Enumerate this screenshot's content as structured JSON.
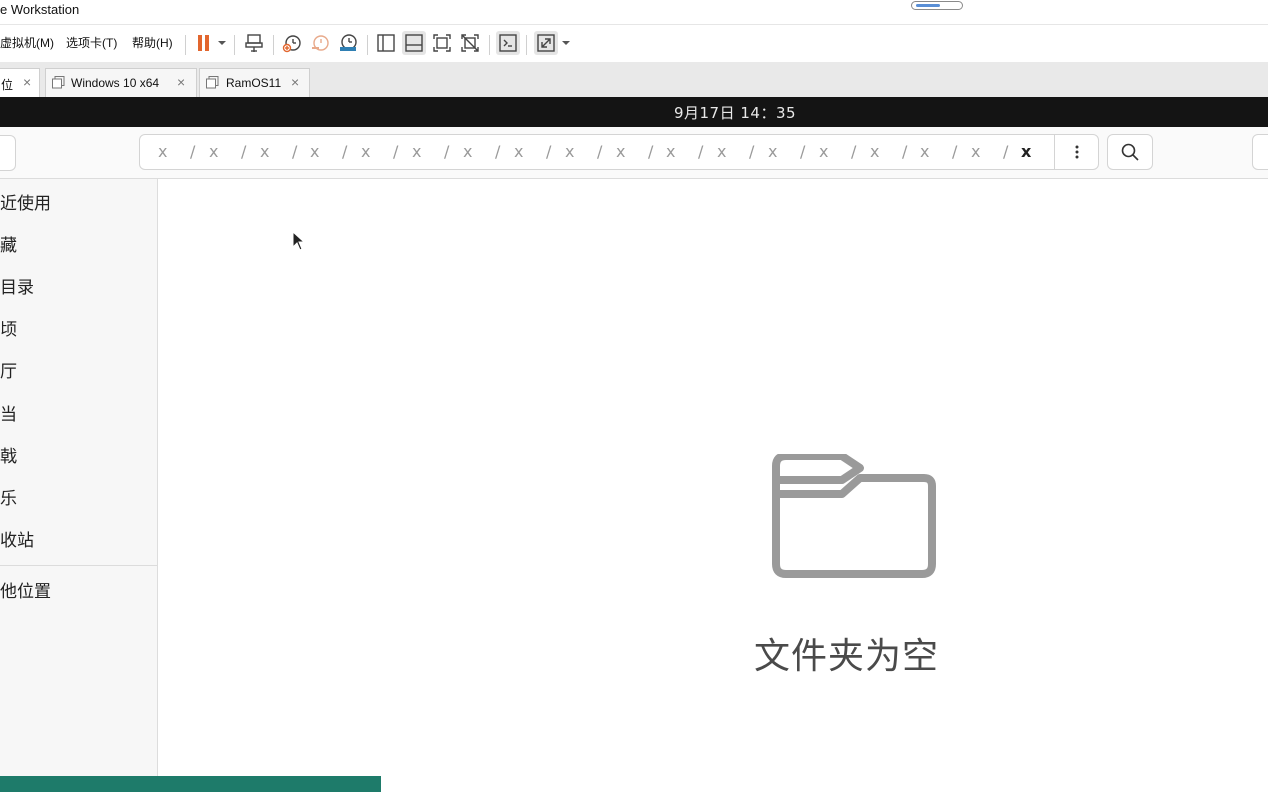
{
  "window": {
    "title": "e Workstation"
  },
  "menubar": {
    "items": [
      "虚拟机(M)",
      "选项卡(T)",
      "帮助(H)"
    ],
    "icons": [
      "pause-icon",
      "send-ctrl-alt-del-icon",
      "snapshot-icon",
      "revert-snapshot-icon",
      "snapshot-manager-icon",
      "library-view-icon",
      "thumbnail-view-icon",
      "fullscreen-icon",
      "unity-icon",
      "console-view-icon",
      "stretch-guest-icon"
    ]
  },
  "tabs": [
    {
      "label": "位",
      "active": true
    },
    {
      "label": "Windows 10 x64",
      "active": false
    },
    {
      "label": "RamOS11",
      "active": false
    }
  ],
  "guest_panel": {
    "clock": "9月17日  14：35"
  },
  "pathbar": {
    "crumbs": [
      "x",
      "x",
      "x",
      "x",
      "x",
      "x",
      "x",
      "x",
      "x",
      "x",
      "x",
      "x",
      "x",
      "x",
      "x",
      "x",
      "x",
      "x"
    ],
    "separator": "/"
  },
  "sidebar": {
    "items": [
      "近使用",
      "藏",
      "目录",
      "顷",
      "厅",
      "当",
      "戟",
      "乐",
      "收站",
      "他位置"
    ]
  },
  "content": {
    "empty_message": "文件夹为空"
  },
  "colors": {
    "accent_pause": "#e2662e",
    "snapshot_blue": "#2f7fb3",
    "bottom_bar": "#1e7b6a"
  }
}
